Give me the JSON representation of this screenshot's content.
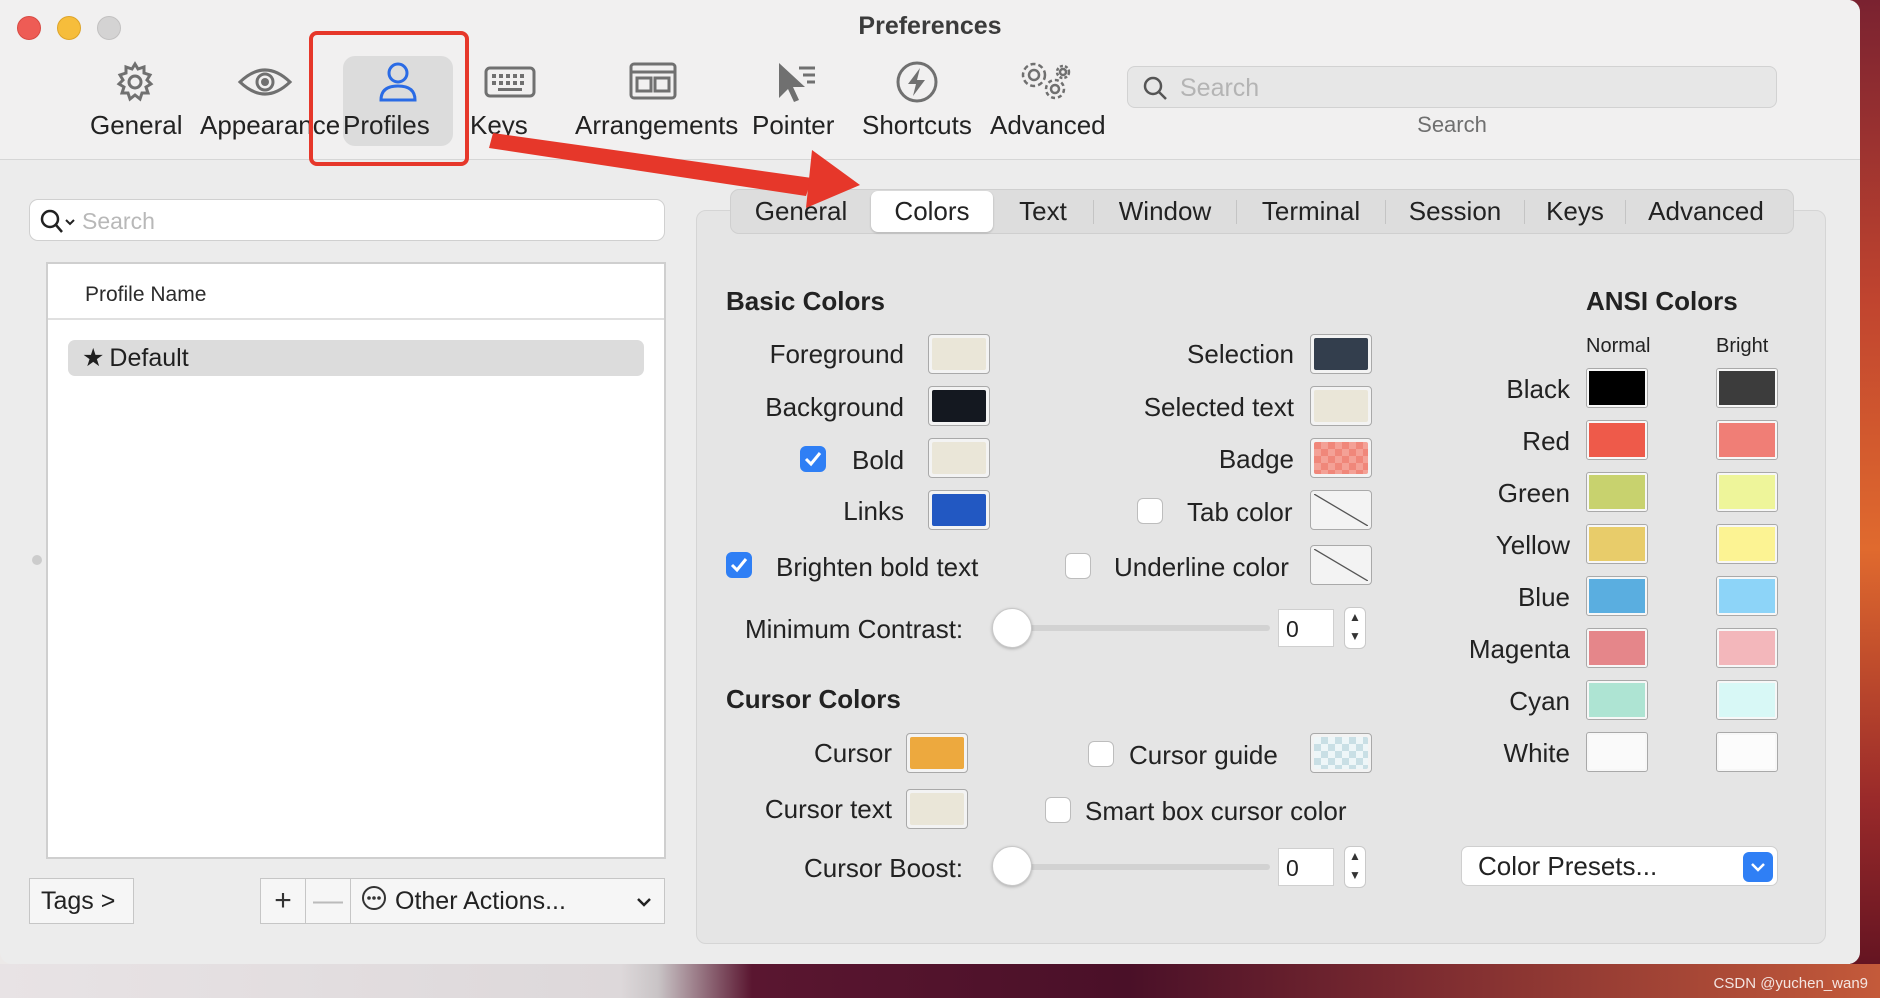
{
  "window": {
    "title": "Preferences"
  },
  "toolbar": {
    "items": [
      {
        "label": "General",
        "icon": "gear-icon"
      },
      {
        "label": "Appearance",
        "icon": "eye-icon"
      },
      {
        "label": "Profiles",
        "icon": "person-icon"
      },
      {
        "label": "Keys",
        "icon": "keyboard-icon"
      },
      {
        "label": "Arrangements",
        "icon": "windows-icon"
      },
      {
        "label": "Pointer",
        "icon": "cursor-icon"
      },
      {
        "label": "Shortcuts",
        "icon": "bolt-icon"
      },
      {
        "label": "Advanced",
        "icon": "gears-icon"
      }
    ],
    "selected": "Profiles",
    "search_placeholder": "Search",
    "search_caption": "Search"
  },
  "profiles": {
    "search_placeholder": "Search",
    "column_header": "Profile Name",
    "items": [
      {
        "name": "Default",
        "icon": "star-icon"
      }
    ],
    "tags_button": "Tags >",
    "add_button": "+",
    "remove_button": "—",
    "other_actions": "Other Actions..."
  },
  "tabs": {
    "items": [
      "General",
      "Colors",
      "Text",
      "Window",
      "Terminal",
      "Session",
      "Keys",
      "Advanced"
    ],
    "selected": "Colors"
  },
  "basic_colors": {
    "title": "Basic Colors",
    "foreground": {
      "label": "Foreground",
      "color": "#eae6d8"
    },
    "background": {
      "label": "Background",
      "color": "#141820"
    },
    "bold": {
      "label": "Bold",
      "color": "#eae6d8",
      "checked": true
    },
    "links": {
      "label": "Links",
      "color": "#2258c2"
    },
    "selection": {
      "label": "Selection",
      "color": "#333e4d"
    },
    "selected_text": {
      "label": "Selected text",
      "color": "#eae6d8"
    },
    "badge": {
      "label": "Badge",
      "color": "#f0877a"
    },
    "tab_color": {
      "label": "Tab color",
      "checked": false
    },
    "underline_color": {
      "label": "Underline color",
      "checked": false
    },
    "brighten_bold": {
      "label": "Brighten bold text",
      "checked": true
    },
    "min_contrast": {
      "label": "Minimum Contrast:",
      "value": "0"
    }
  },
  "cursor_colors": {
    "title": "Cursor Colors",
    "cursor": {
      "label": "Cursor",
      "color": "#eda93e"
    },
    "cursor_text": {
      "label": "Cursor text",
      "color": "#eae6d8"
    },
    "cursor_guide": {
      "label": "Cursor guide",
      "checked": false
    },
    "smart_box": {
      "label": "Smart box cursor color",
      "checked": false
    },
    "cursor_boost": {
      "label": "Cursor Boost:",
      "value": "0"
    }
  },
  "ansi": {
    "title": "ANSI Colors",
    "normal_header": "Normal",
    "bright_header": "Bright",
    "rows": [
      {
        "name": "Black",
        "normal": "#000000",
        "bright": "#3c3c3c"
      },
      {
        "name": "Red",
        "normal": "#ee5a4a",
        "bright": "#f07e76"
      },
      {
        "name": "Green",
        "normal": "#c8d26e",
        "bright": "#eef59a"
      },
      {
        "name": "Yellow",
        "normal": "#e8cc6a",
        "bright": "#fcf393"
      },
      {
        "name": "Blue",
        "normal": "#5aaee0",
        "bright": "#8dd4f8"
      },
      {
        "name": "Magenta",
        "normal": "#e5868a",
        "bright": "#f3b7bb"
      },
      {
        "name": "Cyan",
        "normal": "#aee4d3",
        "bright": "#d8f8f6"
      },
      {
        "name": "White",
        "normal": "#fafafa",
        "bright": "#fcfcfc"
      }
    ],
    "presets": "Color Presets..."
  },
  "watermark": "CSDN @yuchen_wan9"
}
